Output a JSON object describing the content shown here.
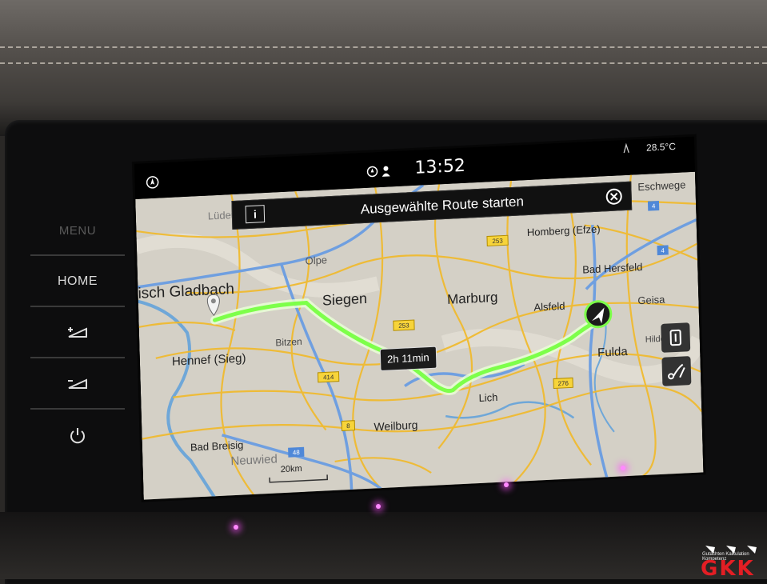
{
  "dash": {
    "side_buttons": [
      {
        "label": "MENU",
        "kind": "menu"
      },
      {
        "label": "HOME",
        "kind": "home"
      },
      {
        "label": "",
        "kind": "brightness-up"
      },
      {
        "label": "",
        "kind": "brightness-down"
      },
      {
        "label": "",
        "kind": "power"
      }
    ]
  },
  "status": {
    "time": "13:52",
    "temperature": "28.5",
    "temperature_unit": "°C"
  },
  "banner": {
    "text": "Ausgewählte Route starten",
    "info_label": "i"
  },
  "route": {
    "duration": "2h 11min",
    "color": "#7dff4a"
  },
  "map": {
    "cities": [
      "Lüdenscheid",
      "Olpe",
      "Eschwege",
      "Homberg (Efze)",
      "Bad Hersfeld",
      "isch Gladbach",
      "Siegen",
      "Marburg",
      "Alsfeld",
      "Geisa",
      "Hennef (Sieg)",
      "Bitzen",
      "Fulda",
      "Hilders",
      "Lich",
      "Weilburg",
      "Bad Breisig",
      "Neuwied"
    ],
    "road_badges": [
      "253",
      "253",
      "414",
      "276",
      "8",
      "48",
      "4",
      "4"
    ],
    "scale_label": "20km"
  },
  "watermark": {
    "caption": "Gutachten Kalkulation Kompetenz",
    "logo": "GKK"
  }
}
